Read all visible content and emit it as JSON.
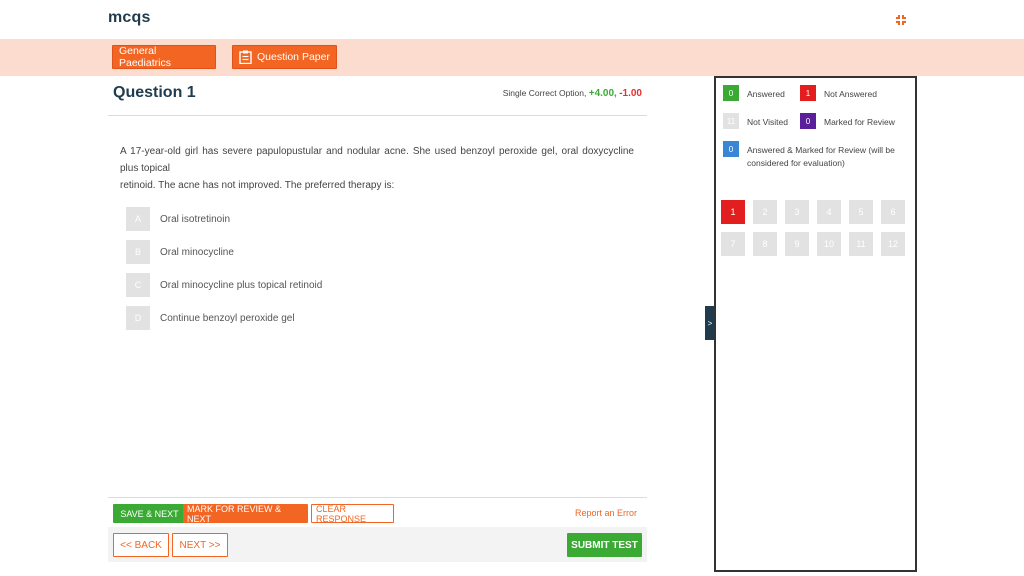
{
  "header": {
    "brand": "mcqs"
  },
  "subbar": {
    "subject": "General Paediatrics",
    "question_paper": "Question Paper"
  },
  "question": {
    "title": "Question 1",
    "type_label": "Single Correct Option,",
    "positive": "+4.00,",
    "negative": "-1.00",
    "text_lines": [
      "A 17-year-old girl has severe papulopustular and nodular acne. She used benzoyl peroxide gel, oral doxycycline plus topical",
      "retinoid. The acne has not improved. The preferred therapy is:"
    ],
    "options": [
      {
        "letter": "A",
        "text": "Oral isotretinoin"
      },
      {
        "letter": "B",
        "text": "Oral minocycline"
      },
      {
        "letter": "C",
        "text": "Oral minocycline plus topical retinoid"
      },
      {
        "letter": "D",
        "text": "Continue benzoyl peroxide gel"
      }
    ]
  },
  "actions": {
    "save_next": "SAVE & NEXT",
    "mark_review_next": "MARK FOR REVIEW & NEXT",
    "clear_response": "CLEAR RESPONSE",
    "report_error": "Report an Error"
  },
  "nav": {
    "back": "<< BACK",
    "next": "NEXT >>",
    "submit": "SUBMIT TEST"
  },
  "panel": {
    "toggle": ">",
    "legend": {
      "answered": {
        "count": "0",
        "label": "Answered"
      },
      "not_answered": {
        "count": "1",
        "label": "Not Answered"
      },
      "not_visited": {
        "count": "11",
        "label": "Not Visited"
      },
      "marked": {
        "count": "0",
        "label": "Marked for Review"
      },
      "answered_marked": {
        "count": "0",
        "label": "Answered & Marked for Review (will be considered for evaluation)"
      }
    },
    "questions": [
      "1",
      "2",
      "3",
      "4",
      "5",
      "6",
      "7",
      "8",
      "9",
      "10",
      "11",
      "12"
    ],
    "current_question": "1"
  },
  "colors": {
    "accent": "#f26522",
    "answered": "#3aaa35",
    "not_answered": "#e31e1e",
    "not_visited": "#e2e2e2",
    "marked": "#5c1f9c",
    "answered_marked": "#3a86d6",
    "subbar_bg": "#fbdccf"
  }
}
